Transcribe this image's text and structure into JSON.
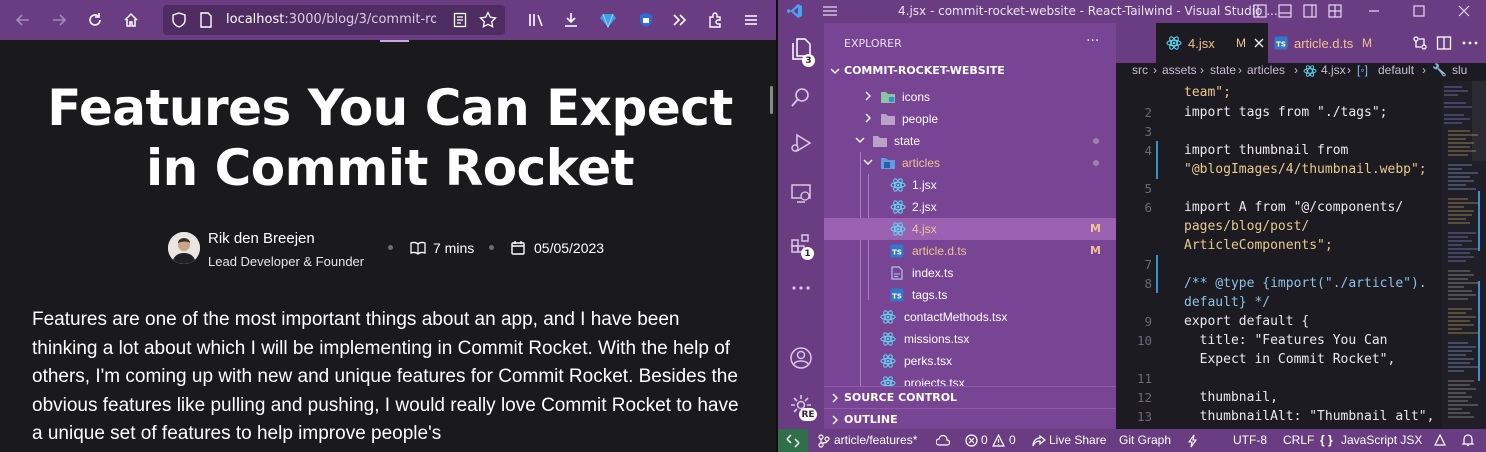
{
  "browser": {
    "url_host": "localhost",
    "url_path": ":3000/blog/3/commit-rocke",
    "article": {
      "title_line1": "Features You Can Expect",
      "title_line2": "in Commit Rocket",
      "author_name": "Rik den Breejen",
      "author_role": "Lead Developer & Founder",
      "read_time": "7 mins",
      "date": "05/05/2023",
      "body": "Features are one of the most important things about an app, and I have been thinking a lot about which I will be implementing in Commit Rocket. With the help of others, I'm coming up with new and unique features for Commit Rocket. Besides the obvious features like pulling and pushing, I would really love Commit Rocket to have a unique set of features to help improve people's"
    }
  },
  "vscode": {
    "title": "4.jsx - commit-rocket-website - React-Tailwind - Visual Studio ...",
    "explorer_label": "EXPLORER",
    "explorer_more": "···",
    "project_label": "COMMIT-ROCKET-WEBSITE",
    "tree": [
      {
        "label": "icons"
      },
      {
        "label": "people"
      },
      {
        "label": "state"
      },
      {
        "label": "articles"
      },
      {
        "label": "1.jsx"
      },
      {
        "label": "2.jsx"
      },
      {
        "label": "4.jsx",
        "flag": "M"
      },
      {
        "label": "article.d.ts",
        "flag": "M"
      },
      {
        "label": "index.ts"
      },
      {
        "label": "tags.ts"
      },
      {
        "label": "contactMethods.tsx"
      },
      {
        "label": "missions.tsx"
      },
      {
        "label": "perks.tsx"
      },
      {
        "label": "projects.tsx"
      }
    ],
    "source_control_label": "SOURCE CONTROL",
    "outline_label": "OUTLINE",
    "activity_badges": {
      "explorer": "3",
      "extensions": "1",
      "account": "RE"
    },
    "tabs": [
      {
        "label": "4.jsx",
        "flag": "M"
      },
      {
        "label": "article.d.ts",
        "flag": "M"
      }
    ],
    "breadcrumb": [
      "src",
      "assets",
      "state",
      "articles",
      "4.jsx",
      "default",
      "slu"
    ],
    "code_lines": [
      {
        "ln": "",
        "text": "team\";"
      },
      {
        "ln": "2",
        "text": "import tags from \"./tags\";"
      },
      {
        "ln": "3",
        "text": ""
      },
      {
        "ln": "4",
        "text": "import thumbnail from"
      },
      {
        "ln": "",
        "text": "\"@blogImages/4/thumbnail.webp\";"
      },
      {
        "ln": "5",
        "text": ""
      },
      {
        "ln": "6",
        "text": "import A from \"@/components/"
      },
      {
        "ln": "",
        "text": "pages/blog/post/"
      },
      {
        "ln": "",
        "text": "ArticleComponents\";"
      },
      {
        "ln": "7",
        "text": ""
      },
      {
        "ln": "8",
        "text": "/** @type {import(\"./article\")."
      },
      {
        "ln": "",
        "text": "default} */"
      },
      {
        "ln": "9",
        "text": "export default {"
      },
      {
        "ln": "10",
        "text": "  title: \"Features You Can"
      },
      {
        "ln": "",
        "text": "  Expect in Commit Rocket\","
      },
      {
        "ln": "11",
        "text": ""
      },
      {
        "ln": "12",
        "text": "  thumbnail,"
      },
      {
        "ln": "13",
        "text": "  thumbnailAlt: \"Thumbnail alt\","
      }
    ],
    "status": {
      "branch": "article/features*",
      "errors": "0",
      "warnings": "0",
      "live_share": "Live Share",
      "git_graph": "Git Graph",
      "encoding": "UTF-8",
      "eol": "CRLF",
      "language": "JavaScript JSX"
    }
  }
}
